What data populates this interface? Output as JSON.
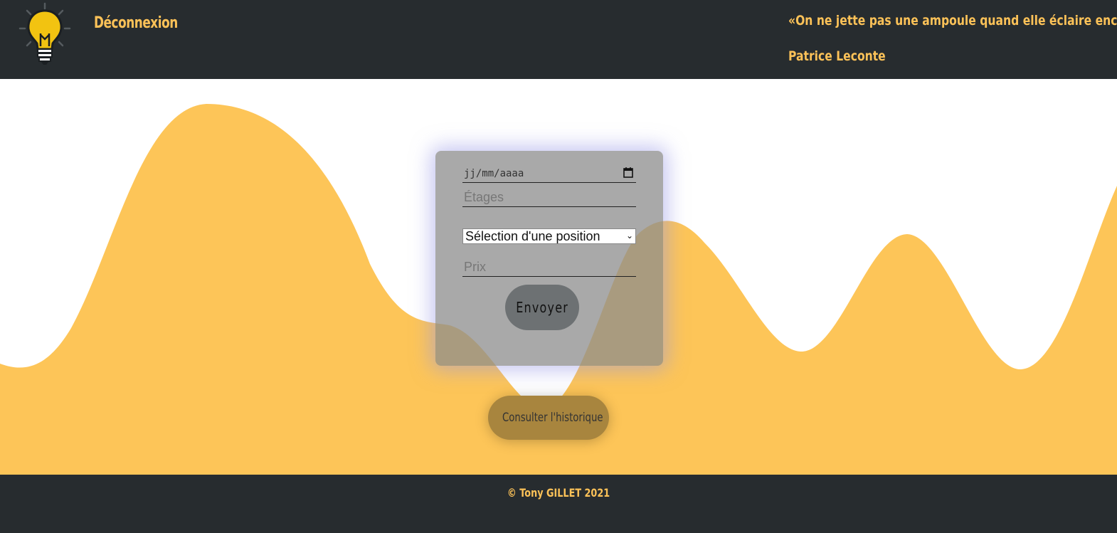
{
  "header": {
    "logout_label": "Déconnexion",
    "quote": "«On ne jette pas une ampoule quand elle éclaire encore. »",
    "author": "Patrice Leconte",
    "logo_icon": "lightbulb-icon"
  },
  "form": {
    "date_placeholder": "jj/mm/aaaa",
    "floors_placeholder": "Étages",
    "position_selected": "Sélection d'une position",
    "price_placeholder": "Prix",
    "submit_label": "Envoyer"
  },
  "history_button_label": "Consulter l'historique",
  "footer": {
    "copyright": "© Tony GILLET 2021"
  },
  "colors": {
    "dark": "#272c2f",
    "accent": "#fcc258",
    "card": "#a3a4a4"
  }
}
